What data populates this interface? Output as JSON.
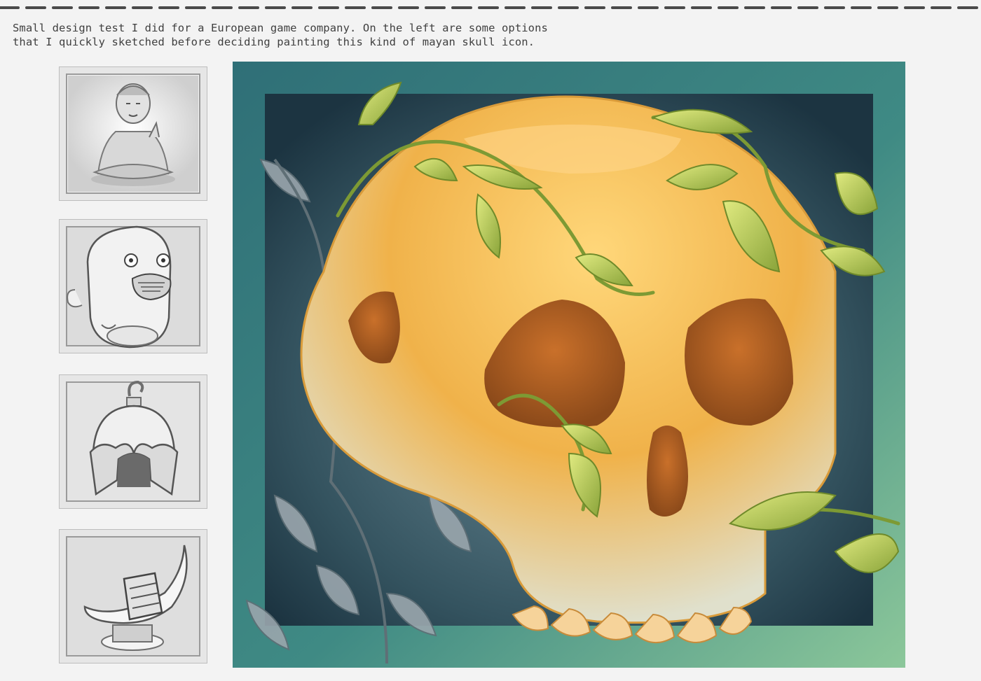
{
  "caption": {
    "line1": "Small design test I did for a European game company. On the left are some options",
    "line2": "that I quickly sketched before deciding painting this kind of mayan skull icon."
  },
  "colors": {
    "page_bg": "#f3f3f3",
    "dash": "#4a4a4a",
    "frame_outer": "#3f8a84",
    "frame_inner": "#1f3d4a",
    "skull": "#f0b24a",
    "leaf": "#b6c94a",
    "sketch": "#8a8a8a"
  },
  "sketches": [
    {
      "name": "buddha-sketch",
      "subject": "seated buddha statue"
    },
    {
      "name": "monkey-head-sketch",
      "subject": "monkey head idol"
    },
    {
      "name": "helmet-sketch",
      "subject": "helmet with hook"
    },
    {
      "name": "banana-hand-sketch",
      "subject": "hand holding banana on pedestal"
    }
  ],
  "main_image": {
    "subject": "mayan skull icon with vines"
  }
}
